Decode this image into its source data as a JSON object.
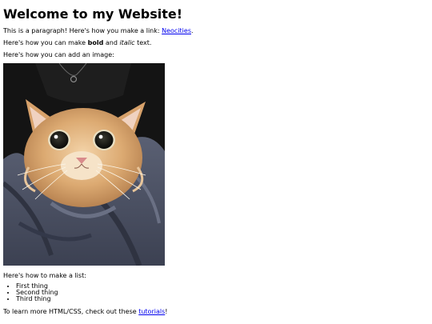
{
  "heading": "Welcome to my Website!",
  "paragraph_link": {
    "before": "This is a paragraph! Here's how you make a link: ",
    "link_text": "Neocities",
    "after": "."
  },
  "paragraph_formatting": {
    "before": "Here's how you can make ",
    "bold": "bold",
    "middle": " and ",
    "italic": "italic",
    "after": " text."
  },
  "paragraph_image": "Here's how you can add an image:",
  "image": {
    "subject": "kitten-photo",
    "colors": {
      "background": "#141414",
      "fur": "#d9a56f",
      "towel": "#4e5468"
    }
  },
  "paragraph_list": "Here's how to make a list:",
  "list_items": [
    "First thing",
    "Second thing",
    "Third thing"
  ],
  "paragraph_footer": {
    "before": "To learn more HTML/CSS, check out these ",
    "link_text": "tutorials",
    "after": "!"
  }
}
